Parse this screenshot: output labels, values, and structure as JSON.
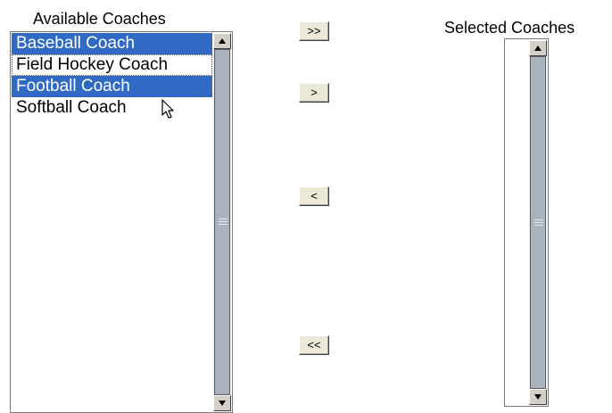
{
  "available": {
    "label": "Available Coaches",
    "items": [
      {
        "label": "Baseball Coach",
        "selected": true
      },
      {
        "label": "Field Hockey Coach",
        "selected": false
      },
      {
        "label": "Football Coach",
        "selected": true
      },
      {
        "label": "Softball Coach",
        "selected": false
      }
    ]
  },
  "selected": {
    "label": "Selected Coaches",
    "items": []
  },
  "buttons": {
    "add_all": ">>",
    "add": ">",
    "remove": "<",
    "remove_all": "<<"
  },
  "colors": {
    "selection": "#316ac5",
    "thumb": "#a9b3be"
  }
}
